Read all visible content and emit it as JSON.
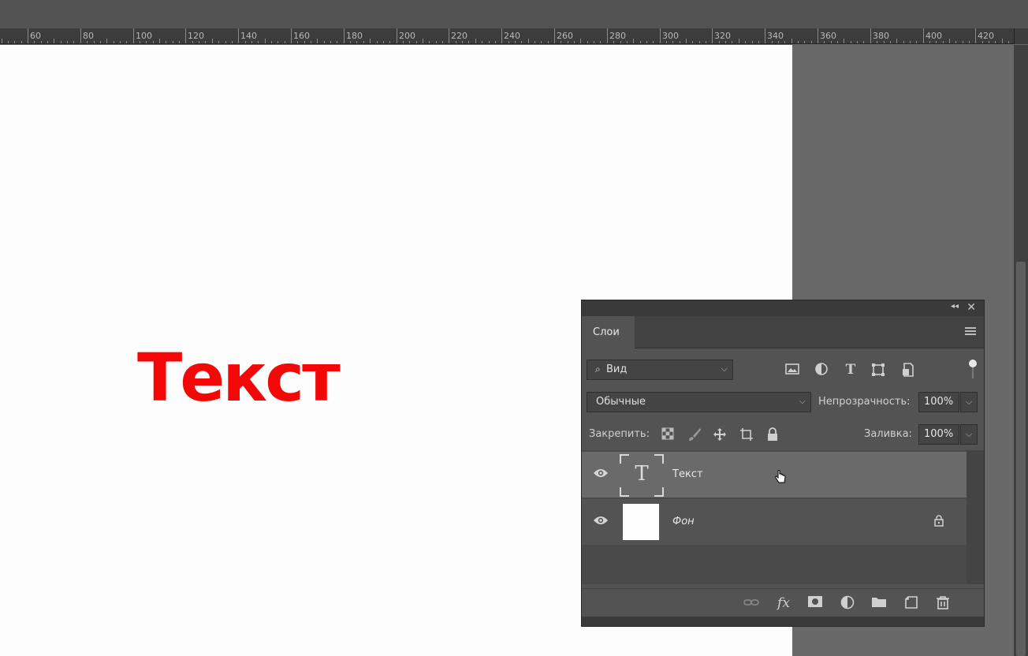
{
  "ruler": {
    "labels": [
      "60",
      "80",
      "100",
      "120",
      "140",
      "160",
      "180",
      "200",
      "220",
      "240",
      "260",
      "280",
      "300",
      "320",
      "340",
      "360",
      "380",
      "400",
      "420"
    ]
  },
  "canvas": {
    "text": "Текст",
    "text_color": "#f30707",
    "background": "#fdfdfd"
  },
  "layers_panel": {
    "collapse_icon": "double-chevron-left-icon",
    "close_icon": "close-icon",
    "tab_label": "Слои",
    "filter": {
      "value": "Вид",
      "icons": [
        "image-filter-icon",
        "adjustment-filter-icon",
        "type-filter-icon",
        "shape-filter-icon",
        "smart-object-filter-icon"
      ]
    },
    "blend_mode": "Обычные",
    "opacity_label": "Непрозрачность:",
    "opacity_value": "100%",
    "lock_label": "Закрепить:",
    "lock_icons": [
      "lock-transparent-pixels-icon",
      "lock-image-pixels-icon",
      "lock-position-icon",
      "lock-artboard-icon",
      "lock-all-icon"
    ],
    "fill_label": "Заливка:",
    "fill_value": "100%",
    "layers": [
      {
        "name": "Текст",
        "type": "text",
        "selected": true,
        "visible": true,
        "locked": false
      },
      {
        "name": "Фон",
        "type": "background",
        "selected": false,
        "visible": true,
        "locked": true
      }
    ],
    "footer_icons": [
      "link-layers-icon",
      "fx-icon",
      "add-mask-icon",
      "adjustment-layer-icon",
      "group-folder-icon",
      "new-layer-icon",
      "trash-icon"
    ],
    "footer_fx": "fx"
  }
}
